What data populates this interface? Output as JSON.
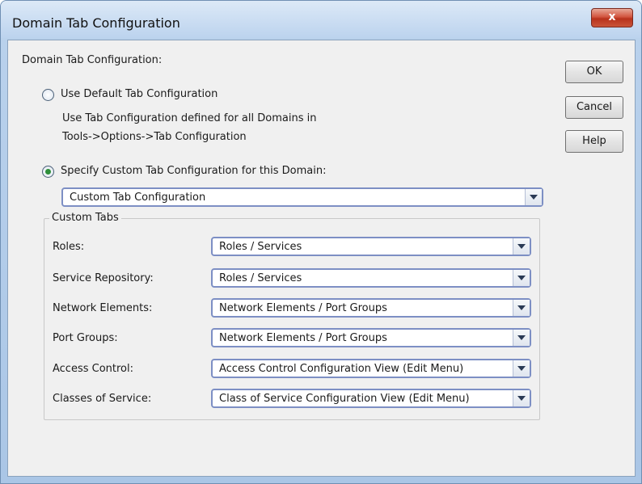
{
  "window": {
    "title": "Domain Tab Configuration",
    "close_label": "x"
  },
  "dialog": {
    "heading": "Domain Tab Configuration:",
    "option_default": {
      "label": "Use Default Tab Configuration",
      "selected": false,
      "description_line1": "Use Tab Configuration defined for all Domains in",
      "description_line2": "Tools->Options->Tab Configuration"
    },
    "option_custom": {
      "label": "Specify Custom Tab Configuration for this Domain:",
      "selected": true
    },
    "config_select": {
      "value": "Custom Tab Configuration"
    }
  },
  "buttons": {
    "ok": "OK",
    "cancel": "Cancel",
    "help": "Help"
  },
  "custom_tabs": {
    "legend": "Custom Tabs",
    "rows": [
      {
        "label": "Roles:",
        "value": "Roles / Services"
      },
      {
        "label": "Service Repository:",
        "value": "Roles / Services"
      },
      {
        "label": "Network Elements:",
        "value": "Network Elements / Port Groups"
      },
      {
        "label": "Port Groups:",
        "value": "Network Elements / Port Groups"
      },
      {
        "label": "Access Control:",
        "value": "Access Control Configuration View (Edit Menu)"
      },
      {
        "label": "Classes of Service:",
        "value": "Class of Service Configuration View (Edit Menu)"
      }
    ]
  },
  "colors": {
    "radio_checked": "#2e8f3a",
    "select_border": "#7d8fc4",
    "close_button": "#c9543a"
  },
  "icons": [
    "close-icon",
    "chevron-down-icon"
  ]
}
